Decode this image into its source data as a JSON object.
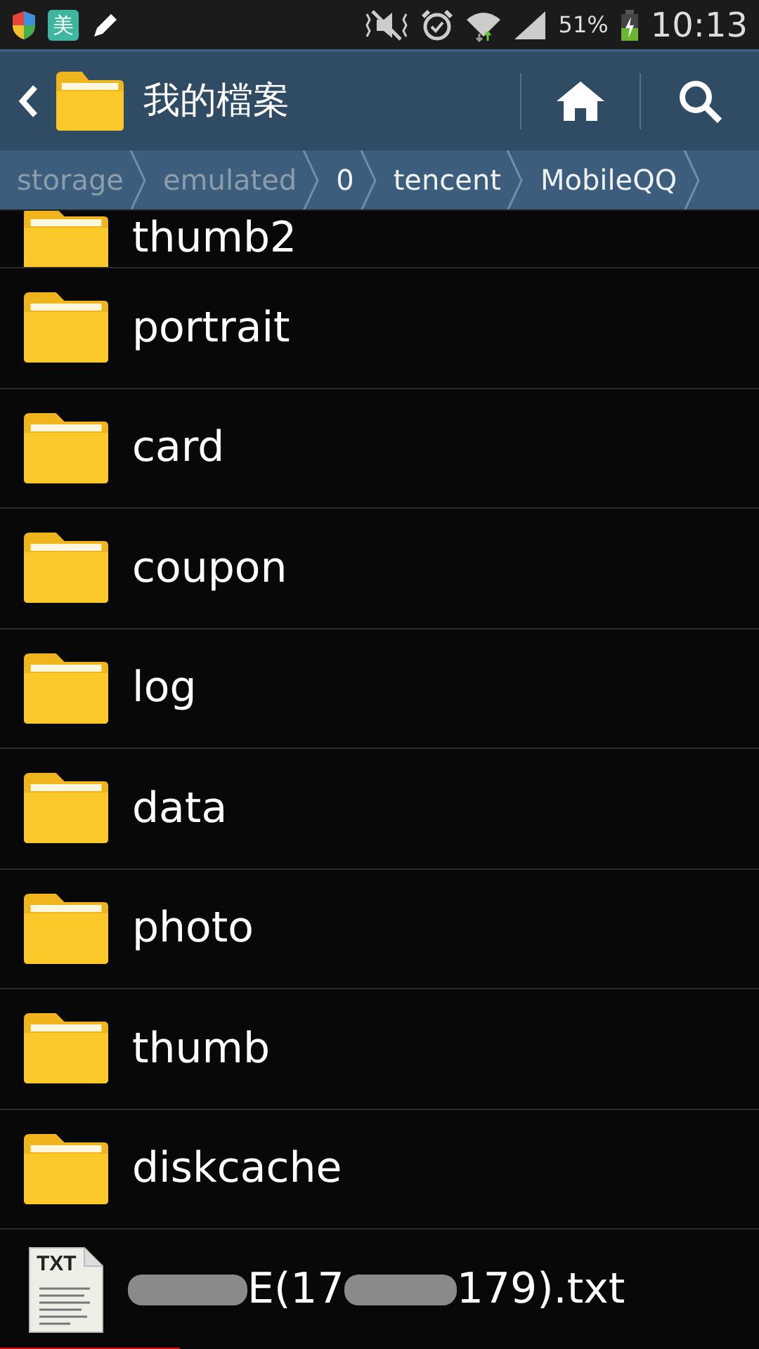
{
  "status_bar": {
    "app_badge": "美",
    "battery_text": "51%",
    "time": "10:13"
  },
  "header": {
    "title": "我的檔案"
  },
  "breadcrumb": [
    {
      "label": "storage",
      "dimmed": true
    },
    {
      "label": "emulated",
      "dimmed": true
    },
    {
      "label": "0",
      "dimmed": false
    },
    {
      "label": "tencent",
      "dimmed": false
    },
    {
      "label": "MobileQQ",
      "dimmed": false
    }
  ],
  "files": [
    {
      "kind": "folder",
      "name": "thumb2",
      "partial": true
    },
    {
      "kind": "folder",
      "name": "portrait"
    },
    {
      "kind": "folder",
      "name": "card"
    },
    {
      "kind": "folder",
      "name": "coupon"
    },
    {
      "kind": "folder",
      "name": "log"
    },
    {
      "kind": "folder",
      "name": "data"
    },
    {
      "kind": "folder",
      "name": "photo"
    },
    {
      "kind": "folder",
      "name": "thumb"
    },
    {
      "kind": "folder",
      "name": "diskcache"
    },
    {
      "kind": "txt",
      "icon_label": "TXT",
      "name_parts": [
        "E(17",
        "179).txt"
      ]
    }
  ]
}
